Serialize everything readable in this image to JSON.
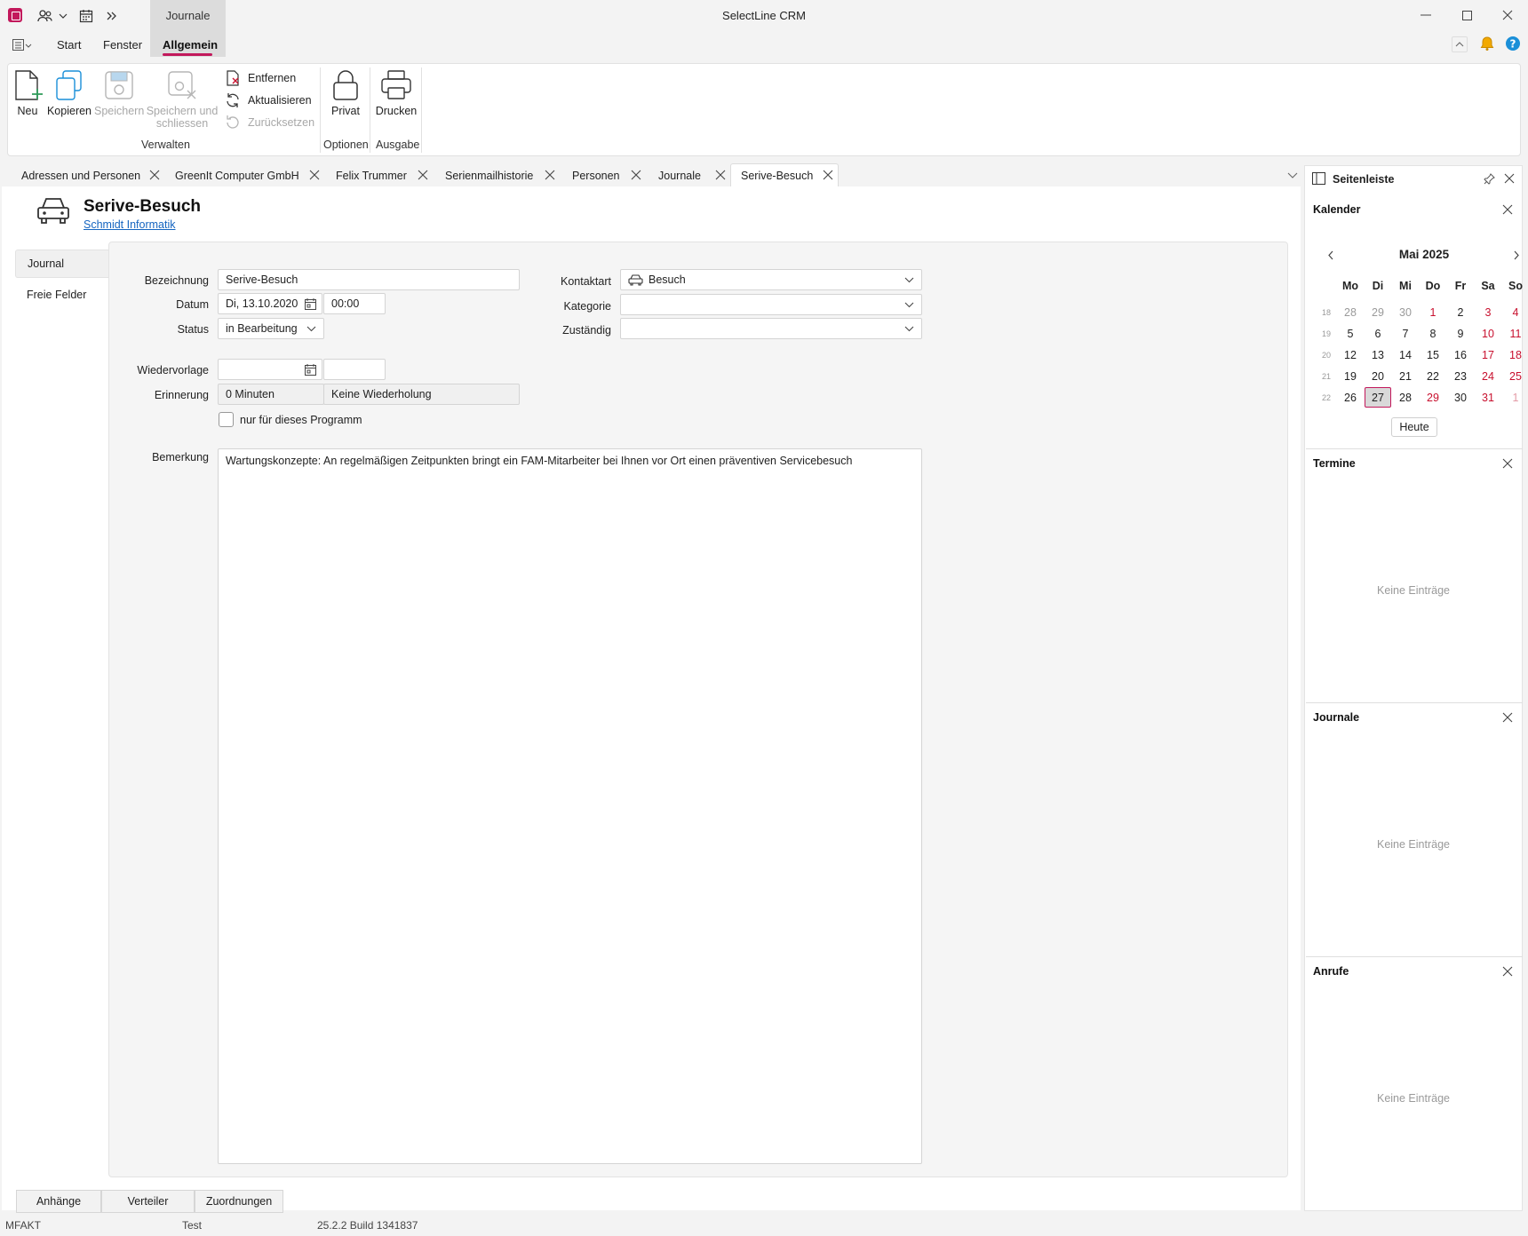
{
  "window": {
    "title": "SelectLine CRM",
    "context_group": "Journale"
  },
  "menu": {
    "start": "Start",
    "fenster": "Fenster",
    "allgemein": "Allgemein"
  },
  "ribbon": {
    "neu": "Neu",
    "kopieren": "Kopieren",
    "speichern": "Speichern",
    "speichern_schliessen_1": "Speichern und",
    "speichern_schliessen_2": "schliessen",
    "entfernen": "Entfernen",
    "aktualisieren": "Aktualisieren",
    "zuruecksetzen": "Zurücksetzen",
    "privat": "Privat",
    "drucken": "Drucken",
    "group_verwalten": "Verwalten",
    "group_optionen": "Optionen",
    "group_ausgabe": "Ausgabe"
  },
  "tabs": [
    "Adressen und Personen",
    "GreenIt Computer GmbH",
    "Felix Trummer",
    "Serienmailhistorie",
    "Personen",
    "Journale",
    "Serive-Besuch"
  ],
  "page": {
    "title": "Serive-Besuch",
    "link": "Schmidt Informatik"
  },
  "side_tabs": {
    "journal": "Journal",
    "freie_felder": "Freie Felder"
  },
  "form": {
    "bezeichnung_label": "Bezeichnung",
    "bezeichnung": "Serive-Besuch",
    "datum_label": "Datum",
    "datum": "Di, 13.10.2020",
    "zeit": "00:00",
    "status_label": "Status",
    "status": "in Bearbeitung",
    "wiedervorlage_label": "Wiedervorlage",
    "erinnerung_label": "Erinnerung",
    "erinnerung": "0 Minuten",
    "wiederholung": "Keine Wiederholung",
    "nur_programm": "nur für dieses Programm",
    "kontaktart_label": "Kontaktart",
    "kontaktart": "Besuch",
    "kategorie_label": "Kategorie",
    "zustaendig_label": "Zuständig",
    "bemerkung_label": "Bemerkung",
    "bemerkung": "Wartungskonzepte: An regelmäßigen Zeitpunkten bringt ein FAM-Mitarbeiter bei Ihnen vor Ort einen präventiven Servicebesuch"
  },
  "bottom_tabs": {
    "anhaenge": "Anhänge",
    "verteiler": "Verteiler",
    "zuordnungen": "Zuordnungen"
  },
  "status_bar": {
    "db": "MFAKT",
    "mandant": "Test",
    "version": "25.2.2 Build 1341837"
  },
  "sidebar": {
    "title": "Seitenleiste",
    "kalender": "Kalender",
    "termine": "Termine",
    "journale": "Journale",
    "anrufe": "Anrufe",
    "empty": "Keine Einträge",
    "heute": "Heute"
  },
  "calendar": {
    "month": "Mai 2025",
    "weekdays": [
      "Mo",
      "Di",
      "Mi",
      "Do",
      "Fr",
      "Sa",
      "So"
    ],
    "weeks": [
      {
        "wk": "18",
        "days": [
          "28",
          "29",
          "30",
          "1",
          "2",
          "3",
          "4"
        ]
      },
      {
        "wk": "19",
        "days": [
          "5",
          "6",
          "7",
          "8",
          "9",
          "10",
          "11"
        ]
      },
      {
        "wk": "20",
        "days": [
          "12",
          "13",
          "14",
          "15",
          "16",
          "17",
          "18"
        ]
      },
      {
        "wk": "21",
        "days": [
          "19",
          "20",
          "21",
          "22",
          "23",
          "24",
          "25"
        ]
      },
      {
        "wk": "22",
        "days": [
          "26",
          "27",
          "28",
          "29",
          "30",
          "31",
          "1"
        ]
      }
    ]
  },
  "colors": {
    "accent": "#c2185b",
    "link": "#1565c0",
    "weekend": "#c8102e"
  }
}
